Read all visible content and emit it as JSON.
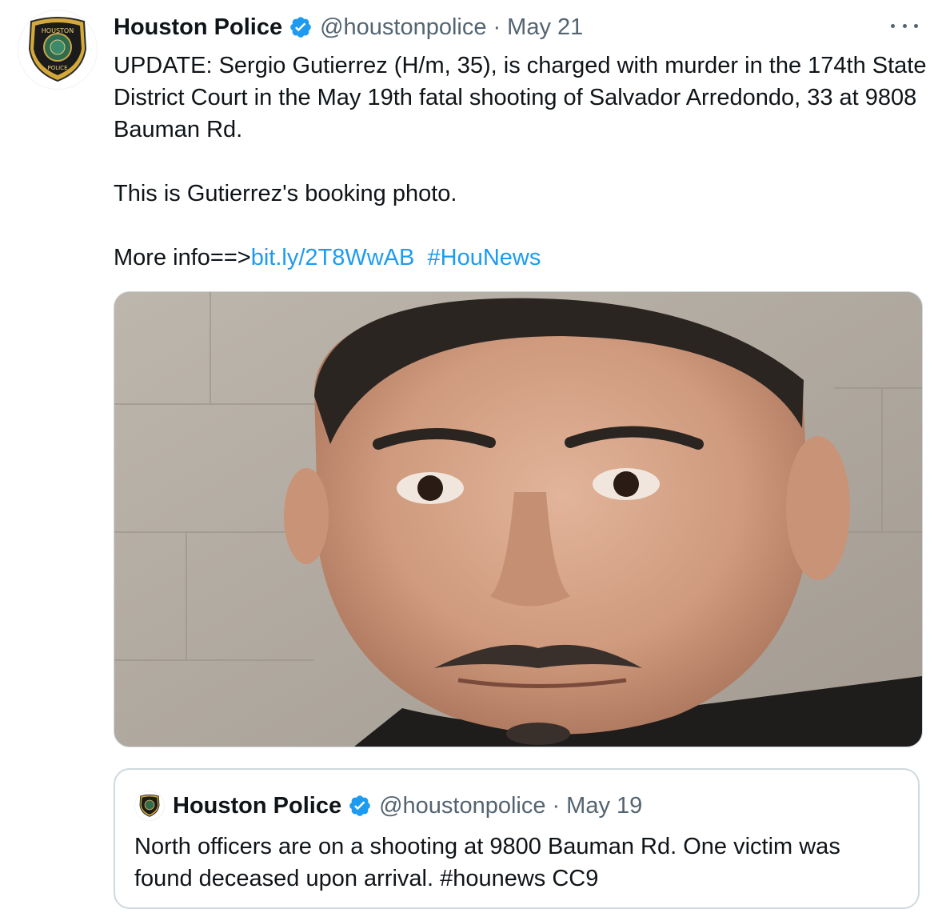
{
  "tweet": {
    "author_name": "Houston Police",
    "verified_icon": "verified-badge-icon",
    "handle": "@houstonpolice",
    "separator": "·",
    "date": "May 21",
    "more_icon": "more-options-icon",
    "text_line1": "UPDATE: Sergio Gutierrez (H/m, 35), is charged with murder in the 174th State District Court in the May 19th fatal shooting of Salvador Arredondo, 33 at 9808 Bauman Rd.",
    "text_line2": "This is Gutierrez's booking photo.",
    "more_info_prefix": "More info==>",
    "link": "bit.ly/2T8WwAB",
    "hashtag": "#HouNews",
    "avatar_badge_text_top": "HOUSTON",
    "avatar_badge_text_bottom": "POLICE",
    "media_alt": "booking photo"
  },
  "quoted_tweet": {
    "author_name": "Houston Police",
    "verified_icon": "verified-badge-icon",
    "handle": "@houstonpolice",
    "separator": "·",
    "date": "May 19",
    "text": "North officers are on a shooting at 9800 Bauman Rd. One victim was found deceased upon arrival. #hounews CC9"
  },
  "colors": {
    "link": "#1d9bf0",
    "secondary_text": "#536471",
    "primary_text": "#0f1419",
    "border": "#cfd9de"
  }
}
